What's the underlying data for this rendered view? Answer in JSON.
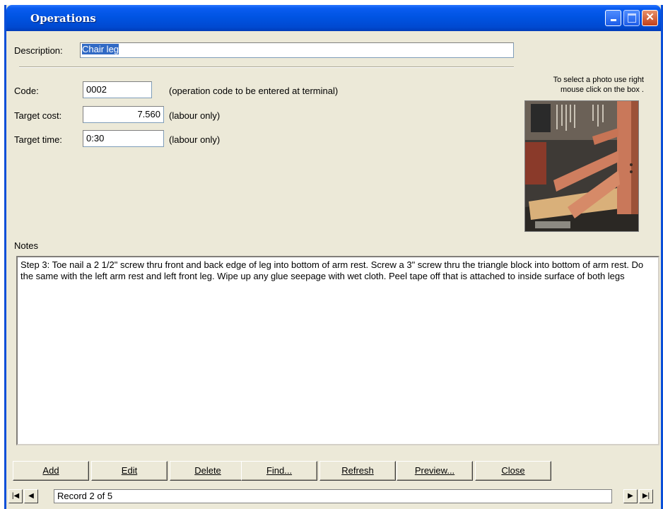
{
  "window": {
    "title": "Operations"
  },
  "form": {
    "description_label": "Description:",
    "description_value": "Chair leg",
    "code_label": "Code:",
    "code_value": "0002",
    "code_hint": "(operation code to be entered at terminal)",
    "target_cost_label": "Target cost:",
    "target_cost_value": "7.560",
    "target_cost_hint": "(labour only)",
    "target_time_label": "Target time:",
    "target_time_value": "0:30",
    "target_time_hint": "(labour only)"
  },
  "photo": {
    "hint_line1": "To select a photo use right",
    "hint_line2": "mouse click on the box ."
  },
  "notes": {
    "label": "Notes",
    "text": "Step 3: Toe nail a 2 1/2\" screw thru front and back edge of leg into bottom of arm rest.   Screw a 3\" screw thru the triangle block into bottom of arm rest.  Do the same with the left arm rest and left front leg.  Wipe up any glue seepage with  wet cloth.  Peel tape off that is attached to inside surface of both legs"
  },
  "buttons": {
    "add": "Add",
    "edit": "Edit",
    "delete": "Delete",
    "find": "Find...",
    "refresh": "Refresh",
    "preview": "Preview...",
    "close": "Close"
  },
  "navigation": {
    "record_text": "Record 2 of 5"
  }
}
